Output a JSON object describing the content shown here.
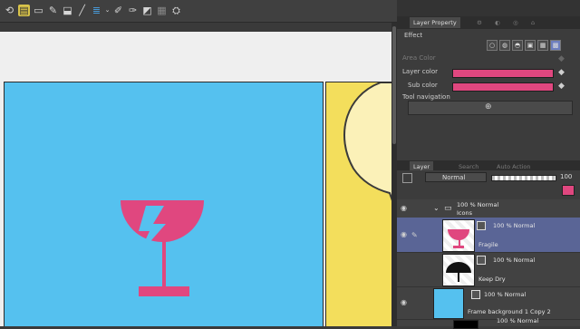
{
  "toolbar": {
    "icons": [
      "undo-icon",
      "layer-icon",
      "save-icon",
      "pen-icon",
      "fill-icon",
      "line-icon",
      "layer-stack-icon",
      "brush-icon",
      "correct-icon",
      "mask-icon",
      "settings-icon"
    ]
  },
  "canvas": {
    "blue_panel_color": "#55c1ef",
    "yellow_panel_color": "#f3de5c",
    "glass_color": "#e0477f"
  },
  "layer_property": {
    "tab_label": "Layer Property",
    "effect_label": "Effect",
    "area_color_label": "Area Color",
    "layer_color_label": "Layer color",
    "sub_color_label": "Sub color",
    "layer_color": "#e0477f",
    "sub_color": "#e0477f",
    "tool_navigation_label": "Tool navigation"
  },
  "layer_panel": {
    "tabs": [
      "Layer",
      "Search",
      "Auto Action"
    ],
    "blend_mode": "Normal",
    "opacity": "100",
    "layers": [
      {
        "meta": "100 % Normal",
        "name": "Icons"
      },
      {
        "meta": "100 % Normal",
        "name": "Fragile"
      },
      {
        "meta": "100 % Normal",
        "name": "Keep Dry"
      },
      {
        "meta": "100 % Normal",
        "name": "Frame background 1 Copy 2"
      },
      {
        "meta": "100 % Normal",
        "name": ""
      }
    ]
  }
}
